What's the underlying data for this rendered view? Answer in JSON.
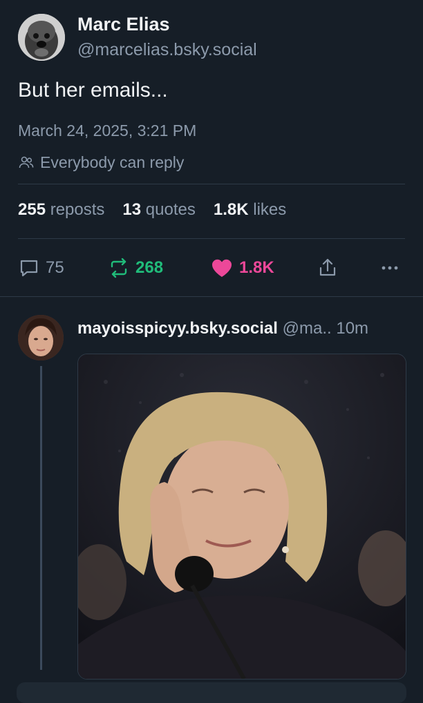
{
  "post": {
    "author_name": "Marc Elias",
    "author_handle": "@marcelias.bsky.social",
    "text": "But her emails...",
    "date": "March 24, 2025, 3:21 PM",
    "reply_setting": "Everybody can reply",
    "stats": {
      "reposts_count": "255",
      "reposts_label": "reposts",
      "quotes_count": "13",
      "quotes_label": "quotes",
      "likes_count": "1.8K",
      "likes_label": "likes"
    },
    "actions": {
      "reply_count": "75",
      "repost_count": "268",
      "like_count": "1.8K"
    }
  },
  "reply": {
    "display_name": "mayoisspicyy.bsky.social",
    "handle": "@ma..",
    "time": "10m"
  },
  "colors": {
    "background": "#161e27",
    "muted_text": "#8c9aab",
    "repost_active": "#20bc7a",
    "like_active": "#ec4899"
  },
  "icons": [
    "people-icon",
    "reply-icon",
    "repost-icon",
    "heart-icon",
    "share-icon",
    "more-icon"
  ]
}
